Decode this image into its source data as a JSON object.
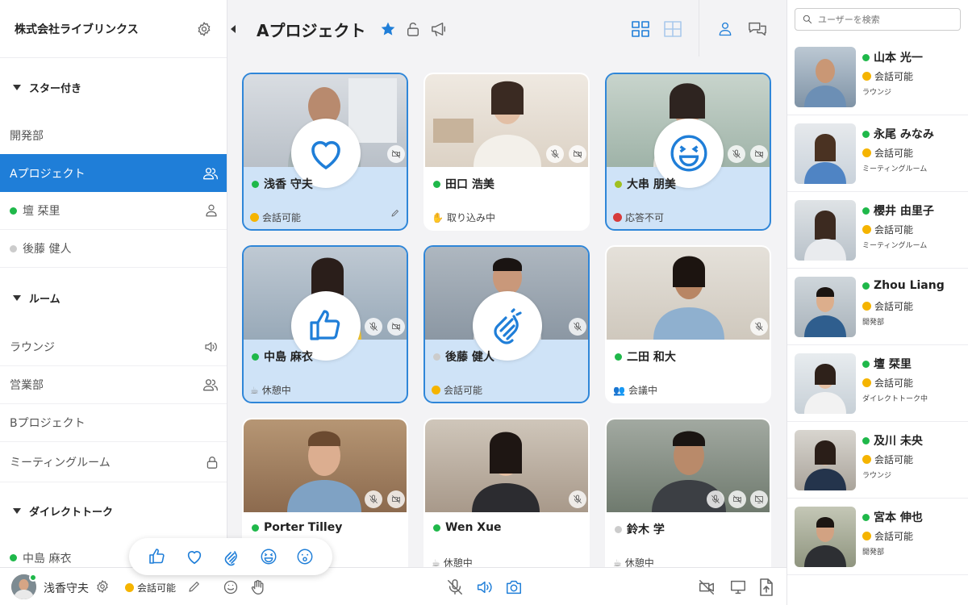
{
  "org": {
    "name": "株式会社ライブリンクス"
  },
  "sidebar": {
    "sections": [
      {
        "label": "スター付き"
      },
      {
        "label": "ルーム"
      },
      {
        "label": "ダイレクトトーク"
      }
    ],
    "starred": [
      {
        "label": "開発部"
      },
      {
        "label": "Aプロジェクト"
      },
      {
        "label": "壇 栞里"
      },
      {
        "label": "後藤 健人"
      }
    ],
    "rooms": [
      {
        "label": "ラウンジ"
      },
      {
        "label": "営業部"
      },
      {
        "label": "Bプロジェクト"
      },
      {
        "label": "ミーティングルーム"
      }
    ],
    "direct": [
      {
        "label": "中島 麻衣"
      }
    ]
  },
  "header": {
    "title": "Aプロジェクト"
  },
  "tiles": [
    {
      "name": "浅香 守夫",
      "status": "会話可能"
    },
    {
      "name": "田口 浩美",
      "status": "取り込み中"
    },
    {
      "name": "大串 朋美",
      "status": "応答不可"
    },
    {
      "name": "中島 麻衣",
      "status": "休憩中"
    },
    {
      "name": "後藤 健人",
      "status": "会話可能"
    },
    {
      "name": "二田 和大",
      "status": "会議中"
    },
    {
      "name": "Porter Tilley",
      "status": ""
    },
    {
      "name": "Wen Xue",
      "status": "休憩中"
    },
    {
      "name": "鈴木 学",
      "status": "休憩中"
    }
  ],
  "right": {
    "search_placeholder": "ユーザーを検索",
    "users": [
      {
        "name": "山本 光一",
        "status": "会話可能",
        "location": "ラウンジ"
      },
      {
        "name": "永尾 みなみ",
        "status": "会話可能",
        "location": "ミーティングルーム"
      },
      {
        "name": "櫻井 由里子",
        "status": "会話可能",
        "location": "ミーティングルーム"
      },
      {
        "name": "Zhou Liang",
        "status": "会話可能",
        "location": "開発部"
      },
      {
        "name": "壇 栞里",
        "status": "会話可能",
        "location": "ダイレクトトーク中"
      },
      {
        "name": "及川 未央",
        "status": "会話可能",
        "location": "ラウンジ"
      },
      {
        "name": "宮本 伸也",
        "status": "会話可能",
        "location": "開発部"
      }
    ]
  },
  "footer": {
    "user_name": "浅香守夫",
    "status": "会話可能"
  },
  "colors": {
    "accent": "#1f7ed8",
    "online": "#1fb84a",
    "offline": "#cccccc"
  }
}
